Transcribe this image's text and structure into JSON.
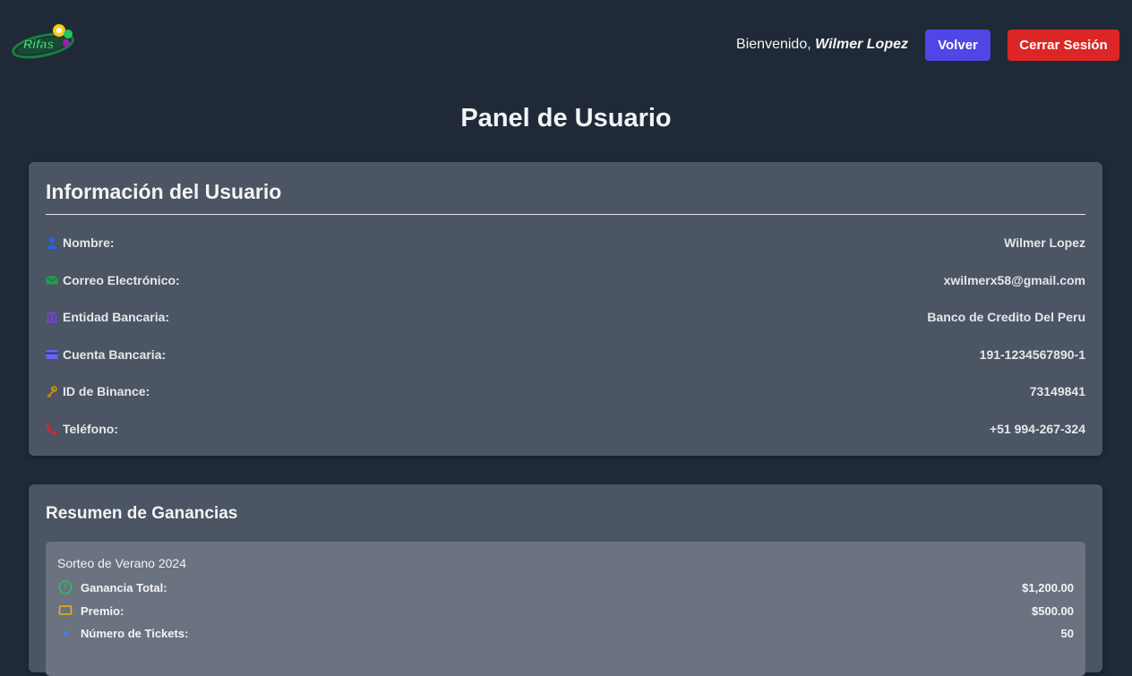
{
  "header": {
    "logo_text": "Rifas",
    "welcome_prefix": "Bienvenido,",
    "user_name": "Wilmer Lopez",
    "back_label": "Volver",
    "logout_label": "Cerrar Sesión"
  },
  "page_title": "Panel de Usuario",
  "user_info": {
    "title": "Información del Usuario",
    "rows": [
      {
        "icon": "user-icon",
        "color": "#2563eb",
        "label": "Nombre:",
        "value": "Wilmer Lopez"
      },
      {
        "icon": "envelope-icon",
        "color": "#16a34a",
        "label": "Correo Electrónico:",
        "value": "xwilmerx58@gmail.com"
      },
      {
        "icon": "bank-icon",
        "color": "#7c3aed",
        "label": "Entidad Bancaria:",
        "value": "Banco de Credito Del Peru"
      },
      {
        "icon": "credit-card-icon",
        "color": "#6366f1",
        "label": "Cuenta Bancaria:",
        "value": "191-1234567890-1"
      },
      {
        "icon": "key-icon",
        "color": "#ca8a04",
        "label": "ID de Binance:",
        "value": "73149841"
      },
      {
        "icon": "phone-icon",
        "color": "#dc2626",
        "label": "Teléfono:",
        "value": "+51 994-267-324"
      }
    ]
  },
  "earnings": {
    "title": "Resumen de Ganancias",
    "raffles": [
      {
        "name": "Sorteo de Verano 2024",
        "stats": [
          {
            "icon": "clock-icon",
            "color": "#22c55e",
            "label": "Ganancia Total:",
            "value": "$1,200.00"
          },
          {
            "icon": "ticket-icon",
            "color": "#eab308",
            "label": "Premio:",
            "value": "$500.00"
          },
          {
            "icon": "dot-icon",
            "color": "#3b82f6",
            "label": "Número de Tickets:",
            "value": "50"
          }
        ]
      }
    ]
  }
}
